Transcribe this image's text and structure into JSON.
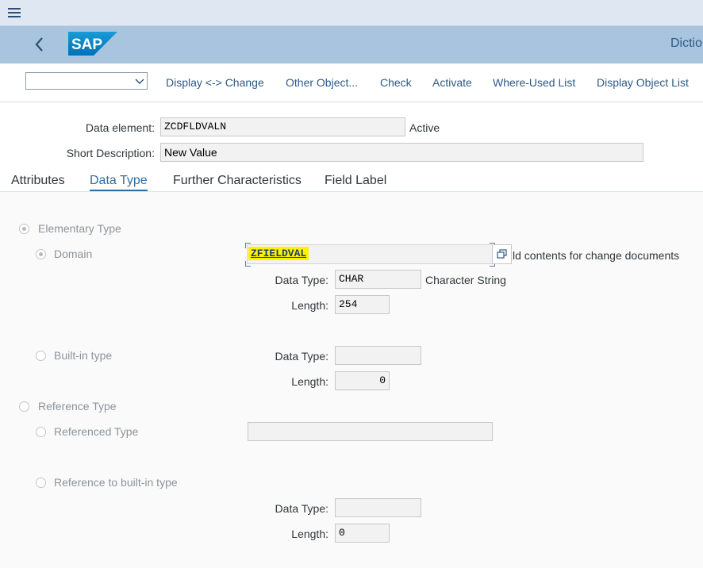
{
  "app": {
    "title": "Dictio",
    "logo_text": "SAP"
  },
  "toolbar": {
    "command_value": "",
    "buttons": [
      "Display <-> Change",
      "Other Object...",
      "Check",
      "Activate",
      "Where-Used List",
      "Display Object List"
    ]
  },
  "header": {
    "data_element_label": "Data element:",
    "data_element_value": "ZCDFLDVALN",
    "status": "Active",
    "short_desc_label": "Short Description:",
    "short_desc_value": "New Value"
  },
  "tabs": [
    "Attributes",
    "Data Type",
    "Further Characteristics",
    "Field Label"
  ],
  "active_tab": "Data Type",
  "data_type": {
    "elementary_label": "Elementary Type",
    "domain_label": "Domain",
    "domain_value": "ZFIELDVAL",
    "clipped_description": "ld contents for change documents",
    "domain_datatype_label": "Data Type:",
    "domain_datatype_value": "CHAR",
    "domain_datatype_desc": "Character String",
    "domain_length_label": "Length:",
    "domain_length_value": "254",
    "builtin_label": "Built-in type",
    "builtin_datatype_label": "Data Type:",
    "builtin_datatype_value": "",
    "builtin_length_label": "Length:",
    "builtin_length_value": "0",
    "reference_label": "Reference Type",
    "referenced_type_label": "Referenced Type",
    "referenced_type_value": "",
    "ref_builtin_label": "Reference to built-in type",
    "ref_datatype_label": "Data Type:",
    "ref_datatype_value": "",
    "ref_length_label": "Length:",
    "ref_length_value": "0"
  },
  "colors": {
    "header": "#a9c4de",
    "menubar": "#dfe8f2",
    "link": "#2d5a86",
    "highlight": "#fff200"
  }
}
